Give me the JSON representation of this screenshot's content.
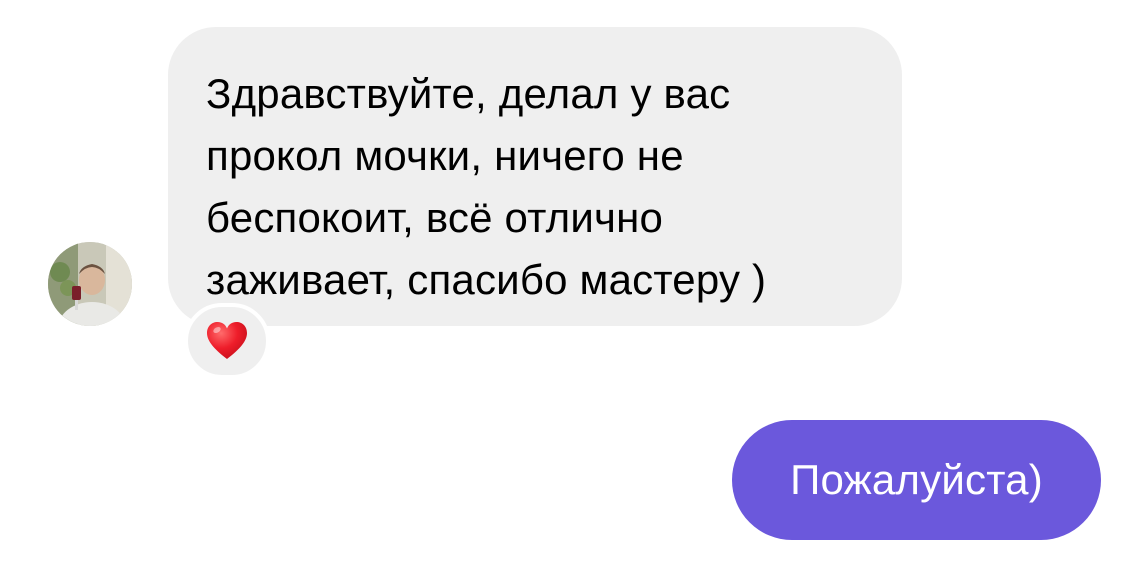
{
  "chat": {
    "incoming_message": {
      "text": "Здравствуйте, делал у вас\nпрокол мочки, ничего не\nбеспокоит, всё отлично\nзаживает, спасибо мастеру )",
      "reaction": "❤️",
      "reaction_icon": "red-heart-icon",
      "bubble_color": "#efefef"
    },
    "outgoing_message": {
      "text": "Пожалуйста)",
      "bubble_color": "#6b58dc",
      "text_color": "#ffffff"
    }
  }
}
